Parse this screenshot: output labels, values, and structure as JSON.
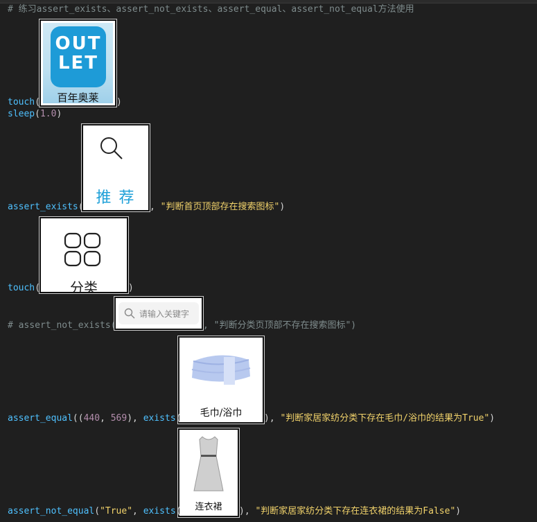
{
  "lines": {
    "l1": "# 练习assert_exists、assert_not_exists、assert_equal、assert_not_equal方法使用",
    "touch": "touch",
    "open": "(",
    "close": ")",
    "sleep_fn": "sleep",
    "sleep_arg": "1.0",
    "assert_exists_fn": "assert_exists",
    "assert_exists_msg": "\"判断首页顶部存在搜索图标\"",
    "comma": ", ",
    "comment_prefix": "# assert_not_exists(",
    "comment_suffix": ", \"判断分类页顶部不存在搜索图标\")",
    "assert_equal_fn": "assert_equal",
    "tuple_open": "((",
    "num1": "440",
    "num2": "569",
    "tuple_close": "), ",
    "exists_fn": "exists",
    "assert_equal_msg": "\"判断家居家纺分类下存在毛巾/浴巾的结果为True\"",
    "assert_not_equal_fn": "assert_not_equal",
    "true_str": "\"True\"",
    "assert_not_equal_msg": "\"判断家居家纺分类下存在连衣裙的结果为False\""
  },
  "images": {
    "outlet_line1": "OUT",
    "outlet_line2": "LET",
    "outlet_caption": "百年奥莱",
    "recommend_caption": "推 荐",
    "category_caption": "分类",
    "search_placeholder": "请输入关键字",
    "towel_caption": "毛巾/浴巾",
    "dress_caption": "连衣裙"
  },
  "colors": {
    "background": "#1f1f1f",
    "function": "#4fc1ff",
    "string": "#f2d36b",
    "number": "#b48ead",
    "comment": "#7f8c8d",
    "outlet_blue": "#1e9bd7"
  },
  "icons": [
    "search-icon",
    "grid-icon",
    "towel-image",
    "dress-image",
    "outlet-logo"
  ]
}
